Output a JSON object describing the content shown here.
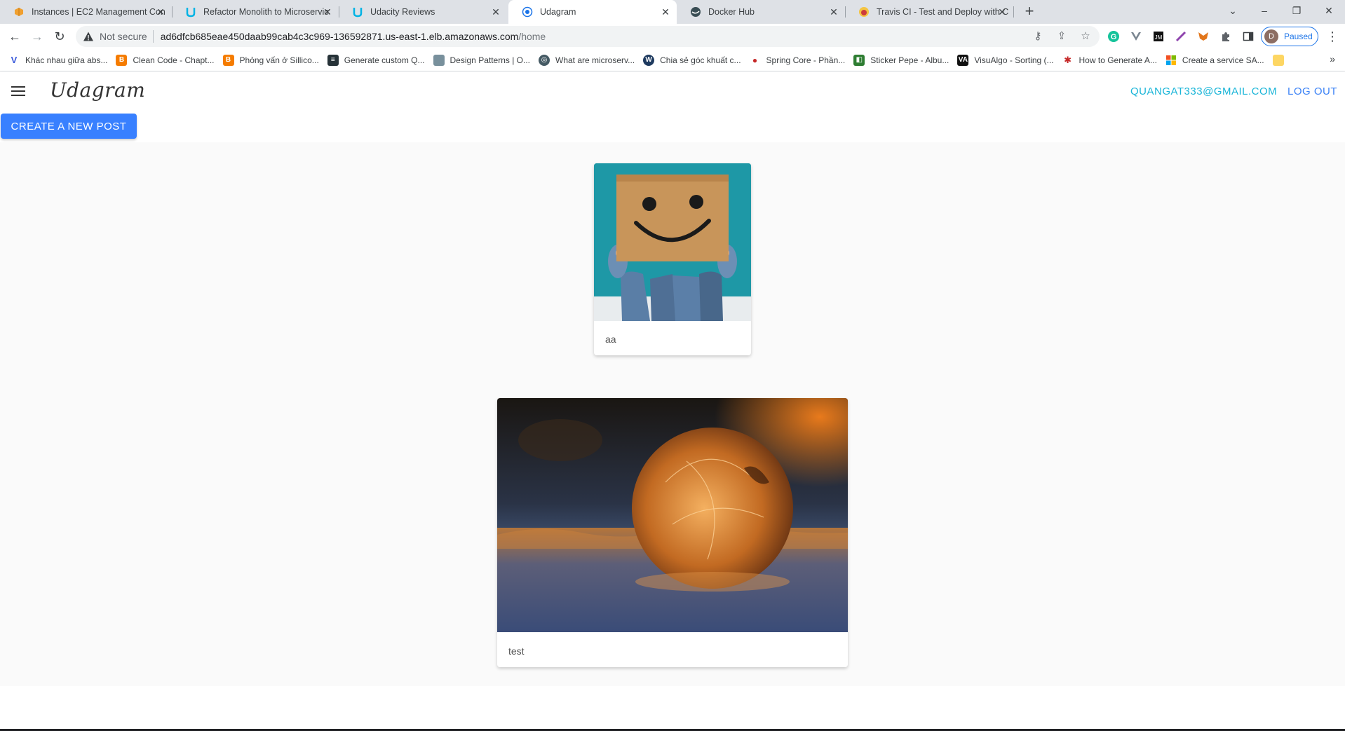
{
  "browser": {
    "tabs": [
      {
        "title": "Instances | EC2 Management Con",
        "icon": "aws-box-icon",
        "active": false
      },
      {
        "title": "Refactor Monolith to Microservic",
        "icon": "udacity-icon",
        "active": false
      },
      {
        "title": "Udacity Reviews",
        "icon": "udacity-icon",
        "active": false
      },
      {
        "title": "Udagram",
        "icon": "globe-icon",
        "active": true
      },
      {
        "title": "Docker Hub",
        "icon": "docker-icon",
        "active": false
      },
      {
        "title": "Travis CI - Test and Deploy with C",
        "icon": "travis-icon",
        "active": false
      }
    ],
    "address": {
      "security_label": "Not secure",
      "host": "ad6dfcb685eae450daab99cab4c3c969-136592871.us-east-1.elb.amazonaws.com",
      "path": "/home"
    },
    "profile_status": "Paused",
    "profile_initial": "D",
    "bookmarks": [
      {
        "label": "Khác nhau giữa abs...",
        "icon": "v-logo-icon",
        "color": "#3b5bdb"
      },
      {
        "label": "Clean Code - Chapt...",
        "icon": "blogger-icon",
        "color": "#f57c00"
      },
      {
        "label": "Phỏng vấn ở Sillico...",
        "icon": "blogger-icon",
        "color": "#f57c00"
      },
      {
        "label": "Generate custom Q...",
        "icon": "app-icon",
        "color": "#263238"
      },
      {
        "label": "Design Patterns | O...",
        "icon": "oodesign-icon",
        "color": "#78909c"
      },
      {
        "label": "What are microserv...",
        "icon": "globe-icon",
        "color": "#455a64"
      },
      {
        "label": "Chia sẻ góc khuất c...",
        "icon": "wordpress-icon",
        "color": "#1e3a5f"
      },
      {
        "label": "Spring Core - Phần...",
        "icon": "dot-icon",
        "color": "#c62828"
      },
      {
        "label": "Sticker Pepe - Albu...",
        "icon": "green-app-icon",
        "color": "#2e7d32"
      },
      {
        "label": "VisuAlgo - Sorting (...",
        "icon": "visualgo-icon",
        "color": "#111111"
      },
      {
        "label": "How to Generate A...",
        "icon": "red-gear-icon",
        "color": "#c62828"
      },
      {
        "label": "Create a service SA...",
        "icon": "microsoft-icon",
        "color": "#f25022"
      },
      {
        "label": "",
        "icon": "folder-icon",
        "color": "#fdd663"
      }
    ]
  },
  "app": {
    "brand": "Udagram",
    "user_email": "QUANGAT333@GMAIL.COM",
    "logout_label": "LOG OUT",
    "create_post_label": "CREATE A NEW POST",
    "feed": [
      {
        "caption": "aa",
        "image": "smiley-box-photo"
      },
      {
        "caption": "test",
        "image": "frozen-bubble-photo"
      }
    ]
  },
  "colors": {
    "accent": "#3880ff",
    "email": "#19b5d8",
    "logout": "#3b82f6"
  }
}
